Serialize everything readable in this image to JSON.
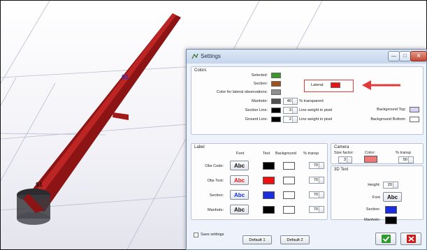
{
  "scene": {
    "labels": [
      "S1",
      "S1"
    ],
    "grid_color": "#b8bcd0",
    "pipe_color": "#8c1414",
    "highlight_color": "#d93030"
  },
  "dialog": {
    "title": "Settings",
    "title_bar_buttons": [
      "minimize",
      "maximize",
      "close"
    ],
    "colors_group": {
      "label": "Colors",
      "selected_label": "Selected:",
      "selected_color": "#3a9a28",
      "section_label": "Section:",
      "section_color": "#a0521a",
      "lateral_obs_label": "Color for lateral observations:",
      "lateral_obs_color": "#909090",
      "manhole_label": "Manhole:",
      "manhole_color": "#505050",
      "manhole_value": "40",
      "manhole_unit": "% transparent",
      "section_line_label": "Section Line:",
      "section_line_color": "#000000",
      "section_line_value": "3",
      "section_line_unit": "Line weight in pixel",
      "ground_line_label": "Ground Line:",
      "ground_line_color": "#000000",
      "ground_line_value": "2",
      "ground_line_unit": "Line weight in pixel",
      "lateral_label": "Lateral:",
      "lateral_color": "#ee1111",
      "bg_top_label": "Background Top:",
      "bg_top_color": "#d6d4f4",
      "bg_bottom_label": "Background Bottom:",
      "bg_bottom_color": "#ffffff",
      "annotation_color": "#e03a3a"
    },
    "label_group": {
      "label": "Label",
      "headers": [
        "Font",
        "Text",
        "Background",
        "% transp"
      ],
      "rows": [
        {
          "name": "Obs Code:",
          "font": "Abc",
          "font_color": "#111111",
          "text_color": "#000000",
          "bg_color": "#ffffff",
          "transp": "70"
        },
        {
          "name": "Obs Text:",
          "font": "Abc",
          "font_color": "#ee1111",
          "text_color": "#ee1111",
          "bg_color": "#ffffff",
          "transp": "70"
        },
        {
          "name": "Section:",
          "font": "Abc",
          "font_color": "#1a2ee0",
          "text_color": "#1a2ee0",
          "bg_color": "#ffffff",
          "transp": "70"
        },
        {
          "name": "Manhole:",
          "font": "Abc",
          "font_color": "#111111",
          "text_color": "#000000",
          "bg_color": "#ffffff",
          "transp": "70"
        }
      ]
    },
    "camera_group": {
      "label": "Camera",
      "size_factor_label": "Size factor:",
      "size_factor_value": "3",
      "color_label": "Color:",
      "color_value": "#ee7777",
      "transp_label": "% transp",
      "transp_value": "50"
    },
    "text3d_group": {
      "label": "3D Text",
      "height_label": "Height:",
      "height_value": "20",
      "font_label": "Font",
      "font_value": "Abc",
      "section_label": "Section:",
      "section_color": "#1a2ee0",
      "manhole_label": "Manhole:",
      "manhole_color": "#000000"
    },
    "footer": {
      "save_settings_label": "Save settings",
      "default1_label": "Default 1",
      "default2_label": "Default 2",
      "ok_color": "#2e9a2e",
      "cancel_color": "#cc1b1b"
    }
  }
}
